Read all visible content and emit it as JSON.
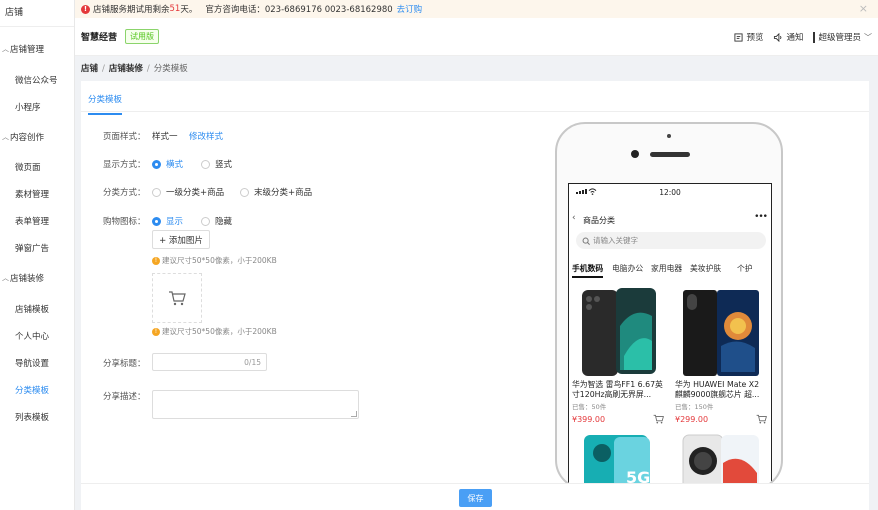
{
  "sidebar": {
    "title": "店铺",
    "groups": [
      {
        "label": "店铺管理",
        "items": [
          "微信公众号",
          "小程序"
        ]
      },
      {
        "label": "内容创作",
        "items": [
          "微页面",
          "素材管理",
          "表单管理",
          "弹窗广告"
        ]
      },
      {
        "label": "店铺装修",
        "items": [
          "店铺模板",
          "个人中心",
          "导航设置",
          "分类模板",
          "列表模板"
        ]
      }
    ],
    "active_item": "分类模板"
  },
  "notice": {
    "prefix": "店铺服务期试用剩余",
    "days": "51",
    "suffix": "天。",
    "phone": "官方咨询电话：023-6869176 0023-68162980",
    "link": "去订购"
  },
  "header": {
    "brand": "智慧经营",
    "badge": "试用版",
    "preview": "预览",
    "notify": "通知",
    "user": "超级管理员"
  },
  "breadcrumb": [
    "店铺",
    "店铺装修",
    "分类模板"
  ],
  "tab": "分类模板",
  "form": {
    "page_style_label": "页面样式：",
    "page_style_value": "样式一",
    "page_style_link": "修改样式",
    "display_label": "显示方式：",
    "display_options": [
      "横式",
      "竖式"
    ],
    "category_label": "分类方式：",
    "category_options": [
      "一级分类+商品",
      "末级分类+商品"
    ],
    "cart_label": "购物图标：",
    "cart_options": [
      "显示",
      "隐藏"
    ],
    "add_image": "+ 添加图片",
    "hint": "建议尺寸50*50像素，小于200KB",
    "share_title_label": "分享标题：",
    "share_title_count": "0/15",
    "share_desc_label": "分享描述："
  },
  "save": "保存",
  "phone": {
    "time": "12:00",
    "title": "商品分类",
    "search_placeholder": "请输入关键字",
    "categories": [
      "手机数码",
      "电脑办公",
      "家用电器",
      "美妆护肤",
      "个护"
    ],
    "products": [
      {
        "name": "华为智选 雷鸟FF1 6.67英寸120Hz高刷无界屏...",
        "sold": "已售：50件",
        "price": "¥399.00"
      },
      {
        "name": "华为 HUAWEI Mate X2 麒麟9000旗舰芯片 超...",
        "sold": "已售：150件",
        "price": "¥299.00"
      }
    ],
    "promo_text": "5G"
  },
  "colors": {
    "accent": "#2d8cf0",
    "price": "#e4393c",
    "trial_green": "#52c41a"
  }
}
